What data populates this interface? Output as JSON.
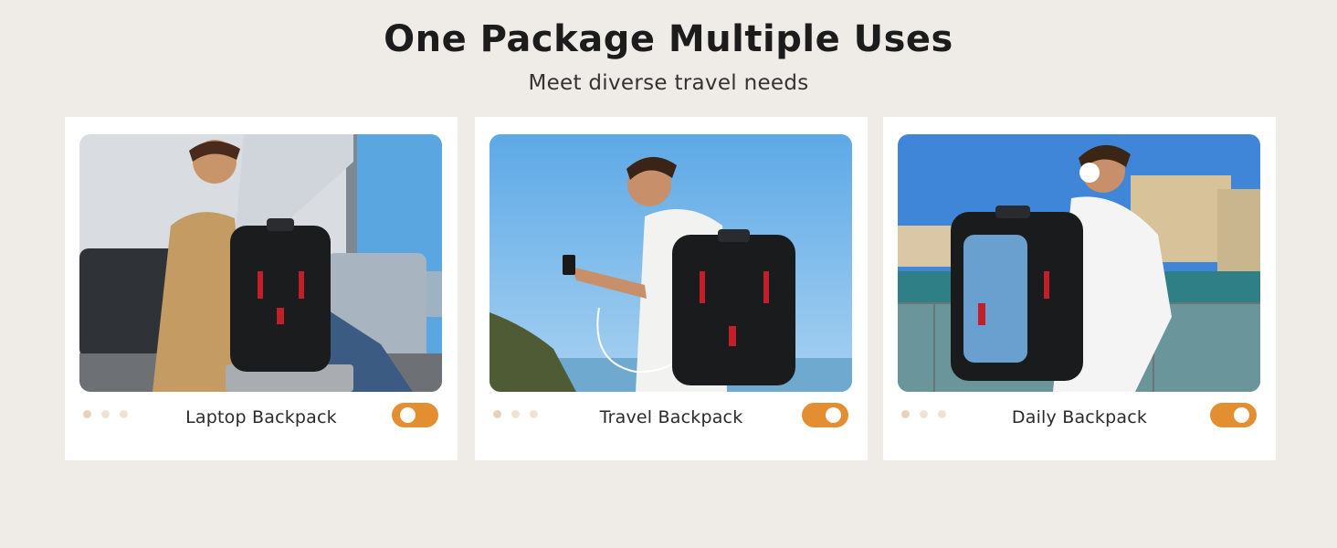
{
  "header": {
    "title": "One Package Multiple Uses",
    "subtitle": "Meet diverse travel needs"
  },
  "cards": [
    {
      "label": "Laptop Backpack",
      "toggle_on": false
    },
    {
      "label": "Travel Backpack",
      "toggle_on": true
    },
    {
      "label": "Daily Backpack",
      "toggle_on": true
    }
  ],
  "colors": {
    "background": "#efebe7",
    "card": "#ffffff",
    "accent": "#e48e32",
    "dot": "#efe3d4"
  }
}
